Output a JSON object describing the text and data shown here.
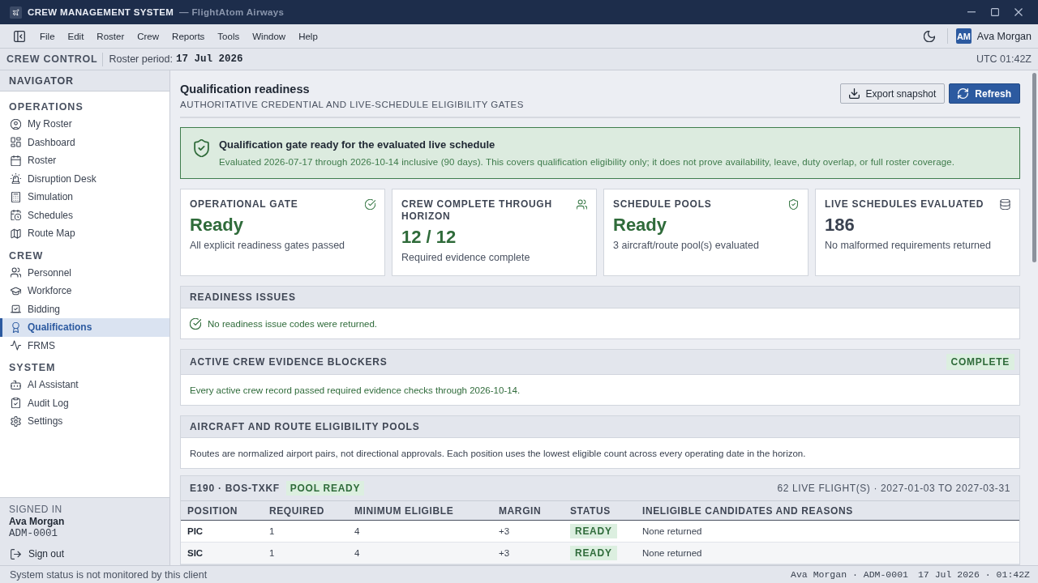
{
  "window": {
    "title": "CREW MANAGEMENT SYSTEM",
    "subtitle": "— FlightAtom Airways"
  },
  "menu": [
    "File",
    "Edit",
    "Roster",
    "Crew",
    "Reports",
    "Tools",
    "Window",
    "Help"
  ],
  "user": {
    "initials": "AM",
    "name": "Ava Morgan"
  },
  "context_bar": {
    "title": "CREW CONTROL",
    "period_label": "Roster period:",
    "period_value": "17 Jul 2026",
    "clock": "UTC 01:42Z"
  },
  "sidebar": {
    "title": "NAVIGATOR",
    "sections": [
      {
        "title": "OPERATIONS",
        "items": [
          {
            "label": "My Roster",
            "selected": false
          },
          {
            "label": "Dashboard",
            "selected": false
          },
          {
            "label": "Roster",
            "selected": false
          },
          {
            "label": "Disruption Desk",
            "selected": false
          },
          {
            "label": "Simulation",
            "selected": false
          },
          {
            "label": "Schedules",
            "selected": false
          },
          {
            "label": "Route Map",
            "selected": false
          }
        ]
      },
      {
        "title": "CREW",
        "items": [
          {
            "label": "Personnel",
            "selected": false
          },
          {
            "label": "Workforce",
            "selected": false
          },
          {
            "label": "Bidding",
            "selected": false
          },
          {
            "label": "Qualifications",
            "selected": true
          },
          {
            "label": "FRMS",
            "selected": false
          }
        ]
      },
      {
        "title": "SYSTEM",
        "items": [
          {
            "label": "AI Assistant",
            "selected": false
          },
          {
            "label": "Audit Log",
            "selected": false
          },
          {
            "label": "Settings",
            "selected": false
          }
        ]
      }
    ],
    "signed_in": {
      "label": "SIGNED IN",
      "name": "Ava Morgan",
      "id": "ADM-0001",
      "sign_out": "Sign out"
    }
  },
  "page": {
    "title": "Qualification readiness",
    "subtitle": "AUTHORITATIVE CREDENTIAL AND LIVE-SCHEDULE ELIGIBILITY GATES",
    "actions": [
      {
        "label": "Export snapshot",
        "primary": false
      },
      {
        "label": "Refresh",
        "primary": true
      }
    ]
  },
  "banner": {
    "title": "Qualification gate ready for the evaluated live schedule",
    "text": "Evaluated 2026-07-17 through 2026-10-14 inclusive (90 days). This covers qualification eligibility only; it does not prove availability, leave, duty overlap, or full roster coverage."
  },
  "stat_cards": [
    {
      "label": "OPERATIONAL GATE",
      "value": "Ready",
      "note": "All explicit readiness gates passed",
      "positive": true
    },
    {
      "label": "CREW COMPLETE THROUGH HORIZON",
      "value": "12 / 12",
      "note": "Required evidence complete",
      "positive": true
    },
    {
      "label": "SCHEDULE POOLS",
      "value": "Ready",
      "note": "3 aircraft/route pool(s) evaluated",
      "positive": true
    },
    {
      "label": "LIVE SCHEDULES EVALUATED",
      "value": "186",
      "note": "No malformed requirements returned",
      "positive": false
    }
  ],
  "readiness_issues": {
    "title": "READINESS ISSUES",
    "message": "No readiness issue codes were returned."
  },
  "evidence_blockers": {
    "title": "ACTIVE CREW EVIDENCE BLOCKERS",
    "badge": "COMPLETE",
    "message": "Every active crew record passed required evidence checks through 2026-10-14."
  },
  "eligibility_pools": {
    "title": "AIRCRAFT AND ROUTE ELIGIBILITY POOLS",
    "message": "Routes are normalized airport pairs, not directional approvals. Each position uses the lowest eligible count across every operating date in the horizon."
  },
  "pools": [
    {
      "name": "E190 · BOS-TXKF",
      "badge": "POOL READY",
      "summary": "62 LIVE FLIGHT(S) · 2027-01-03 TO 2027-03-31",
      "columns": [
        {
          "label": "POSITION",
          "kind": "key"
        },
        {
          "label": "REQUIRED",
          "kind": "text"
        },
        {
          "label": "MINIMUM ELIGIBLE",
          "kind": "text"
        },
        {
          "label": "MARGIN",
          "kind": "text"
        },
        {
          "label": "STATUS",
          "kind": "badge"
        },
        {
          "label": "INELIGIBLE CANDIDATES AND REASONS",
          "kind": "text"
        }
      ],
      "rows": [
        {
          "cells": [
            "PIC",
            "1",
            "4",
            "+3",
            "READY",
            "None returned"
          ]
        },
        {
          "cells": [
            "SIC",
            "1",
            "4",
            "+3",
            "READY",
            "None returned"
          ]
        }
      ]
    }
  ],
  "status_bar": {
    "message": "System status is not monitored by this client",
    "user": "Ava Morgan · ADM-0001",
    "timestamp": "17 Jul 2026 · 01:42Z"
  }
}
